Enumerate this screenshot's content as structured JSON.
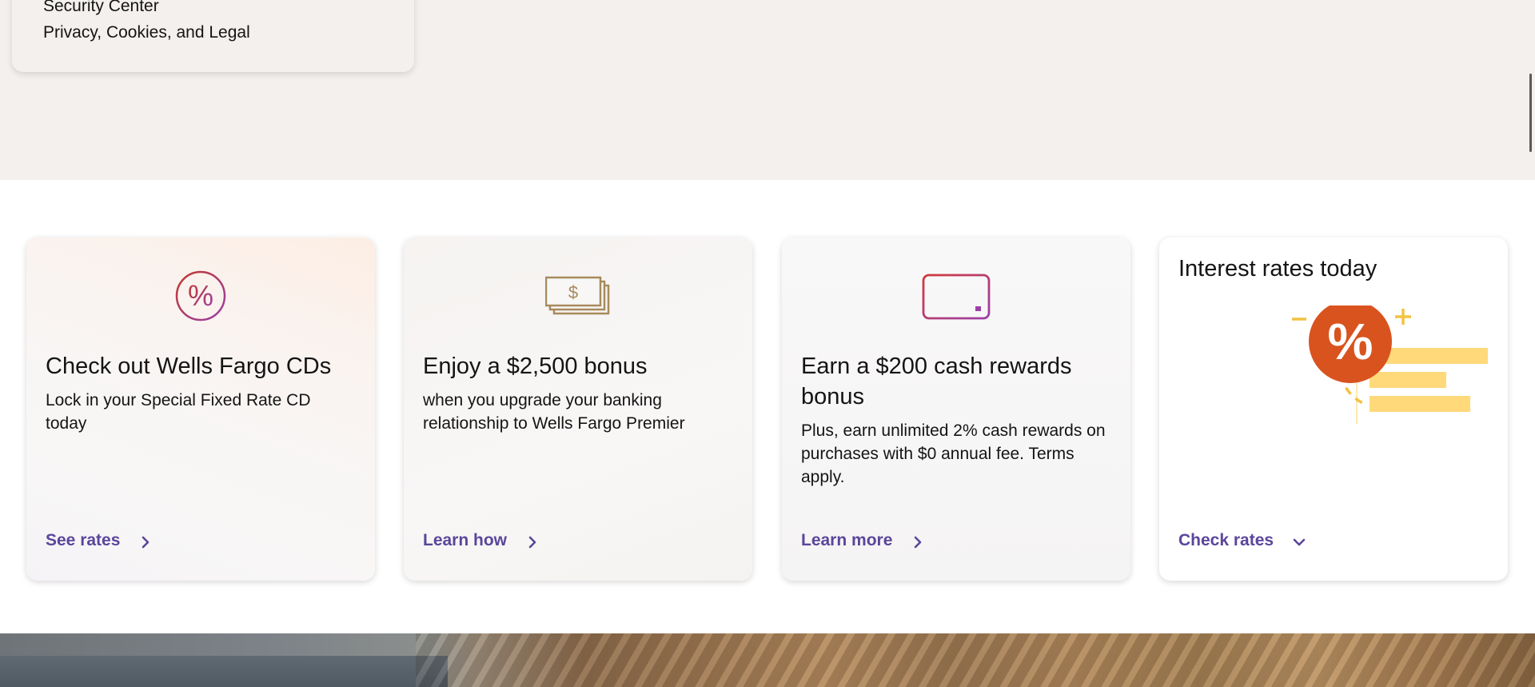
{
  "menu": {
    "items": [
      {
        "label": "Security Center"
      },
      {
        "label": "Privacy, Cookies, and Legal"
      }
    ]
  },
  "cards": [
    {
      "icon": "percent-circle-icon",
      "title": "Check out Wells Fargo CDs",
      "body": "Lock in your Special Fixed Rate CD today",
      "cta": "See rates",
      "cta_icon": "chevron-right-icon"
    },
    {
      "icon": "cash-stack-icon",
      "title": "Enjoy a $2,500 bonus",
      "body": "when you upgrade your banking relationship to Wells Fargo Premier",
      "cta": "Learn how",
      "cta_icon": "chevron-right-icon"
    },
    {
      "icon": "credit-card-icon",
      "title": "Earn a $200 cash rewards bonus",
      "body": "Plus, earn unlimited 2% cash rewards on purchases with $0 annual fee. Terms apply.",
      "cta": "Learn more",
      "cta_icon": "chevron-right-icon"
    },
    {
      "icon": "interest-rates-illustration",
      "title": "Interest rates today",
      "cta": "Check rates",
      "cta_icon": "chevron-down-icon"
    }
  ],
  "colors": {
    "link": "#5a469b",
    "band_background": "#f3f0ed",
    "percent_badge": "#d9531e",
    "illustration_yellow": "#ffd97a",
    "icon_gradient_start": "#c0392b",
    "icon_gradient_end": "#9b3fa8",
    "cash_icon": "#a88a5c"
  }
}
